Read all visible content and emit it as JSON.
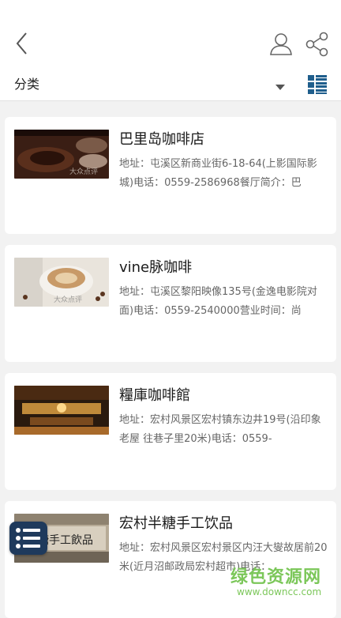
{
  "header": {
    "back_icon": "chevron-left-icon",
    "user_icon": "user-icon",
    "share_icon": "share-icon"
  },
  "filter": {
    "category_label": "分类",
    "dropdown_icon": "caret-down-icon",
    "view_toggle_icon": "grid-list-icon",
    "accent_color": "#1f5e8c"
  },
  "shops": [
    {
      "name": "巴里岛咖啡店",
      "description": "地址：屯溪区新商业街6-18-64(上影国际影城)电话：0559-2586968餐厅简介：巴",
      "photo_watermark": "大众点评"
    },
    {
      "name": "vine脉咖啡",
      "description": "地址：屯溪区黎阳映像135号(金逸电影院对面)电话：0559-2540000营业时间：尚",
      "photo_watermark": "大众点评"
    },
    {
      "name": "糧庫咖啡館",
      "description": "地址：宏村风景区宏村镇东边井19号(沿印象老屋 往巷子里20米)电话：0559-",
      "photo_watermark": ""
    },
    {
      "name": "宏村半糖手工饮品",
      "description": "地址：宏村风景区宏村景区内汪大燮故居前20米(近月沼邮政局宏村超市)电话：",
      "photo_watermark": "糖手工飲品"
    }
  ],
  "float_menu": {
    "icon": "list-menu-icon",
    "color": "#1f3a5c"
  },
  "site_watermark": {
    "title": "绿色资源网",
    "url": "www.downcc.com",
    "color": "#7cc75a"
  }
}
